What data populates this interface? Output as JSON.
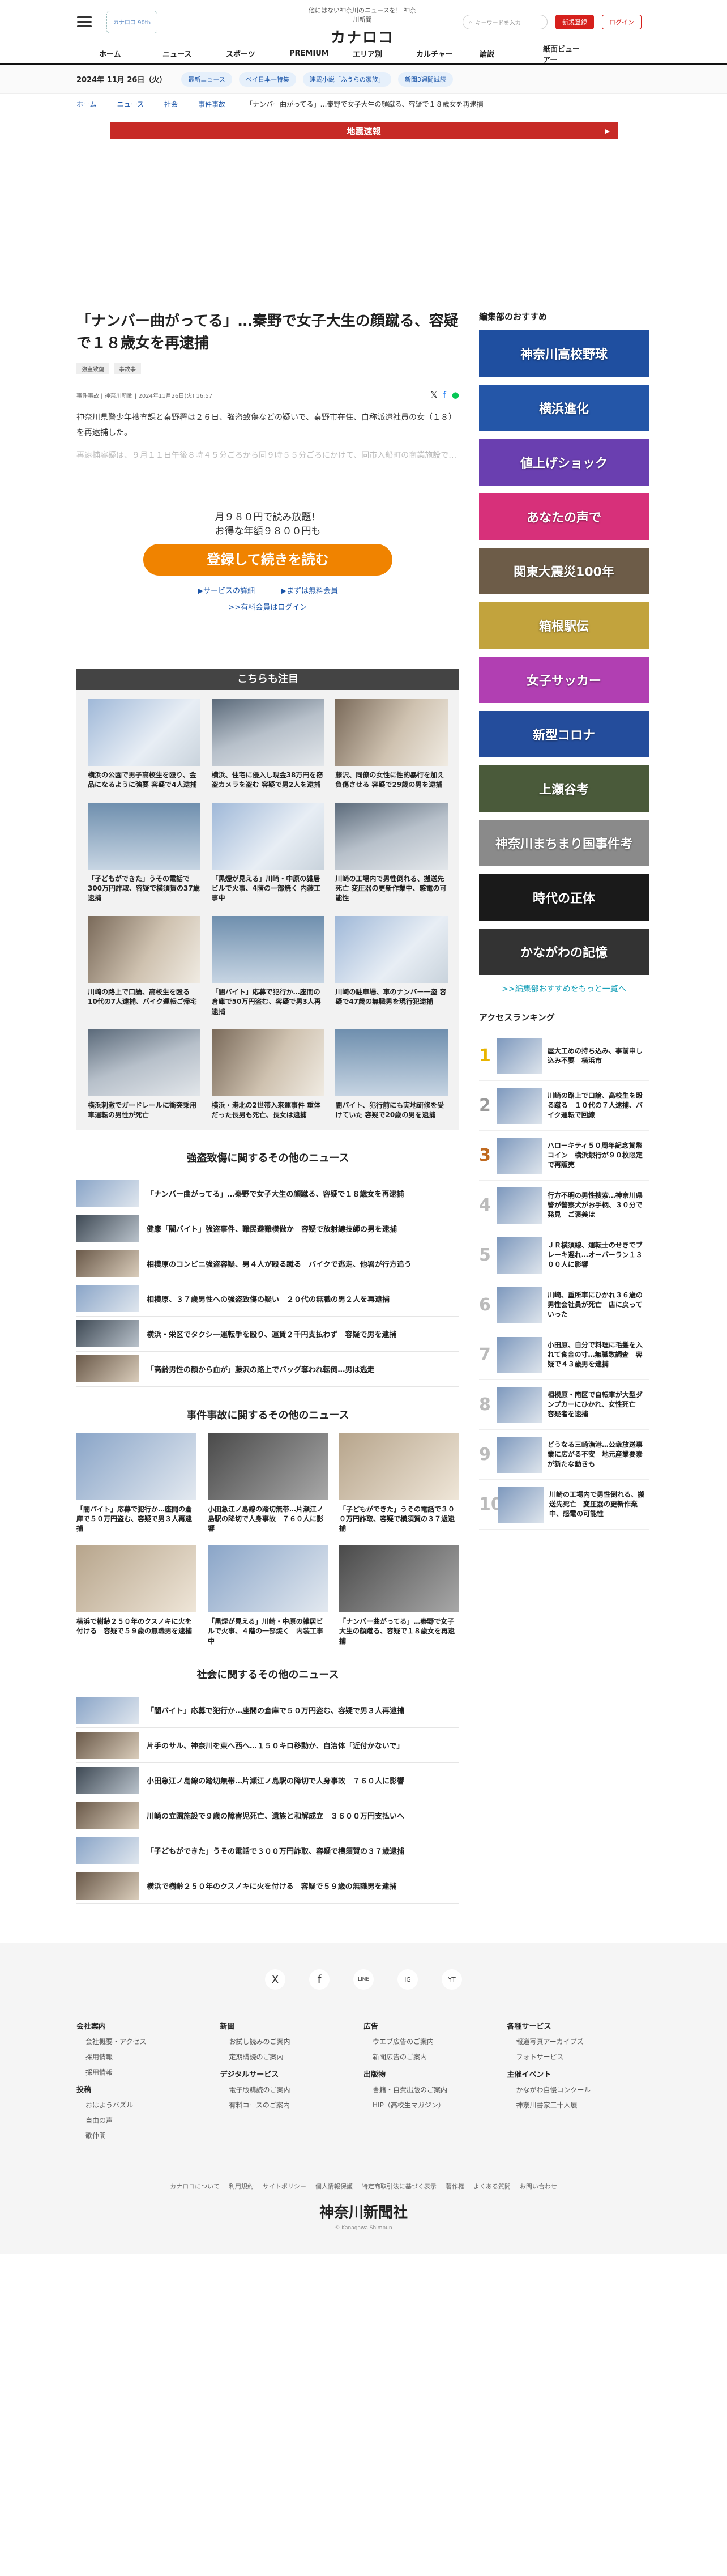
{
  "header": {
    "logo_text": "カナロコ 90th",
    "tagline": "他にはない神奈川のニュースを！ 神奈川新聞",
    "brand": "カナロコ",
    "search_placeholder": "キーワードを入力",
    "register": "新規登録",
    "login": "ログイン"
  },
  "gnav": [
    "ホーム",
    "ニュース",
    "スポーツ",
    "PREMIUM",
    "エリア別",
    "カルチャー",
    "論説",
    "紙面ビューアー"
  ],
  "subbar": {
    "date": "2024年 11月 26日（火）",
    "chips": [
      "最新ニュース",
      "ベイ日本一特集",
      "連載小説「ふうらの家族」",
      "新聞3週間試読"
    ]
  },
  "breadcrumbs": [
    "ホーム",
    "ニュース",
    "社会",
    "事件事故",
    "「ナンバー曲がってる」…秦野で女子大生の顔蹴る、容疑で１８歳女を再逮捕"
  ],
  "alert": "地震速報",
  "article": {
    "title": "「ナンバー曲がってる」…秦野で女子大生の顔蹴る、容疑で１８歳女を再逮捕",
    "tags": [
      "強盗致傷",
      "事故事"
    ],
    "meta": "事件事故 | 神奈川新聞 | 2024年11月26日(火) 16:57",
    "p1": "神奈川県警少年捜査課と秦野署は２６日、強盗致傷などの疑いで、秦野市在住、自称派遣社員の女（１８）を再逮捕した。",
    "p2": "再逮捕容疑は、９月１１日午後８時４５分ごろから同９時５５分ごろにかけて、同市入船町の商業施設で…"
  },
  "paywall": {
    "line1": "月９８０円で読み放題！",
    "line2": "お得な年額９８００円も",
    "cta": "登録して続きを読む",
    "link1": "▶サービスの詳細",
    "link2": "▶まずは無料会員",
    "login": ">>有料会員はログイン"
  },
  "focus": {
    "heading": "こちらも注目",
    "items": [
      "横浜の公園で男子高校生を殴り、金品になるように強要 容疑で4人逮捕",
      "横浜、住宅に侵入し現金38万円を窃盗カメラを盗む 容疑で男2人を逮捕",
      "藤沢、同僚の女性に性的暴行を加え負傷させる 容疑で29歳の男を逮捕",
      "「子どもができた」うその電話で300万円詐取、容疑で横須賀の37歳逮捕",
      "「黒煙が見える」川崎・中原の雑居ビルで火事、4階の一部焼く 内装工事中",
      "川崎の工場内で男性倒れる、搬送先死亡 変圧器の更新作業中、感電の可能性",
      "川崎の路上で口論、高校生を殴る 10代の7人逮捕、バイク運転ご帰宅",
      "「闇バイト」応募で犯行か…座間の倉庫で50万円盗む、容疑で男3人再逮捕",
      "川崎の駐車場、車のナンバー一盗 容疑で47歳の無職男を現行犯逮捕",
      "横浜刺激でガードレールに衝突乗用車運転の男性が死亡",
      "横浜・港北の2世帯入来運事件 重体だった長男も死亡、長女は逮捕",
      "闇バイト、犯行前にも実地研修を受けていた 容疑で20歳の男を逮捕"
    ]
  },
  "related1": {
    "heading": "強盗致傷に関するその他のニュース",
    "items": [
      "「ナンバー曲がってる」…秦野で女子大生の顔蹴る、容疑で１８歳女を再逮捕",
      "健康「闇バイト」強盗事件、難民避難模倣か　容疑で放射線技師の男を逮捕",
      "相模原のコンビニ強盗容疑、男４人が殴る蹴る　バイクで逃走、他署が行方追う",
      "相模原、３７歳男性への強盗致傷の疑い　２０代の無職の男２人を再逮捕",
      "横浜・栄区でタクシー運転手を殴り、運賃２千円支払わず　容疑で男を逮捕",
      "「高齢男性の顔から血が」藤沢の路上でバッグ奪われ転倒…男は逃走"
    ]
  },
  "related2": {
    "heading": "事件事故に関するその他のニュース",
    "items": [
      "「闇バイト」応募で犯行か…座間の倉庫で５０万円盗む、容疑で男３人再逮捕",
      "小田急江ノ島線の踏切無帯…片瀬江ノ島駅の降切で人身事故　７６０人に影響",
      "「子どもができた」うその電話で３００万円詐取、容疑で横須賀の３７歳逮捕",
      "横浜で樹齢２５０年のクスノキに火を付ける　容疑で５９歳の無職男を逮捕",
      "「黒煙が見える」川崎・中原の雑居ビルで火事、４階の一部焼く　内装工事中",
      "「ナンバー曲がってる」…秦野で女子大生の顔蹴る、容疑で１８歳女を再逮捕"
    ]
  },
  "related3": {
    "heading": "社会に関するその他のニュース",
    "items": [
      "「闇バイト」応募で犯行か…座間の倉庫で５０万円盗む、容疑で男３人再逮捕",
      "片手のサル、神奈川を東へ西へ…１５０キロ移動か、自治体「近付かないで」",
      "小田急江ノ島線の踏切無帯…片瀬江ノ島駅の降切で人身事故　７６０人に影響",
      "川崎の立園施設で９歳の障害児死亡、遺族と和解成立　３６００万円支払いへ",
      "「子どもができた」うその電話で３００万円詐取、容疑で横須賀の３７歳逮捕",
      "横浜で樹齢２５０年のクスノキに火を付ける　容疑で５９歳の無職男を逮捕"
    ]
  },
  "side": {
    "heading": "編集部のおすすめ",
    "banners": [
      {
        "text": "神奈川高校野球",
        "color": "#1f4fa0"
      },
      {
        "text": "横浜進化",
        "color": "#2456a8"
      },
      {
        "text": "値上げショック",
        "color": "#6a3fb0"
      },
      {
        "text": "あなたの声で",
        "color": "#d7307a"
      },
      {
        "text": "関東大震災100年",
        "color": "#6d5c48"
      },
      {
        "text": "箱根駅伝",
        "color": "#c2a33d"
      },
      {
        "text": "女子サッカー",
        "color": "#b13fb2"
      },
      {
        "text": "新型コロナ",
        "color": "#244d9c"
      },
      {
        "text": "上瀬谷考",
        "color": "#4a5a3a"
      },
      {
        "text": "神奈川まちまり国事件考",
        "color": "#8a8a8a"
      },
      {
        "text": "時代の正体",
        "color": "#1a1a1a"
      },
      {
        "text": "かながわの記憶",
        "color": "#333333"
      }
    ],
    "more": ">>編集部おすすめをもっと一覧へ",
    "ranking_heading": "アクセスランキング",
    "ranking": [
      "屋大工めの持ち込み、事前申し込み不要　横浜市",
      "川崎の路上で口論、高校生を殴る蹴る　１０代の７人逮捕、バイク運転で回線",
      "ハローキティ５０周年記念貨幣コイン　横浜銀行が９０枚限定で再販売",
      "行方不明の男性捜索…神奈川県警が警察犬がお手柄、３０分で発見　ご褒美は",
      "ＪＲ横須線、運転士のせきでブレーキ遅れ…オーバーラン１３００人に影響",
      "川崎、重所車にひかれ３６歳の男性会社員が死亡　店に戻っていった",
      "小田原、自分で料理に毛髪を入れて食金の寸…無職数調査　容疑で４３歳男を逮捕",
      "相模原・南区で自転車が大型ダンプカーにひかれ、女性死亡　容疑者を逮捕",
      "どうなる三崎漁港…公衆放送事業に広がる不安　地元産業要素が新たな動きも",
      "川崎の工場内で男性倒れる、搬送先死亡　変圧器の更新作業中、感電の可能性"
    ]
  },
  "footer": {
    "social": [
      "X",
      "f",
      "LINE",
      "IG",
      "YT"
    ],
    "cols": [
      {
        "h": "会社案内",
        "links": [
          "会社概要・アクセス",
          "採用情報",
          "採用情報"
        ]
      },
      {
        "h": "新聞",
        "links": [
          "お試し読みのご案内",
          "定期購読のご案内"
        ]
      },
      {
        "h": "広告",
        "links": [
          "ウエブ広告のご案内",
          "新聞広告のご案内"
        ]
      },
      {
        "h": "各種サービス",
        "links": [
          "報道写真アーカイブズ",
          "フォトサービス"
        ]
      }
    ],
    "cols2": [
      {
        "h": "投稿",
        "links": [
          "おはようバズル",
          "自由の声",
          "歌仲間"
        ]
      },
      {
        "h": "デジタルサービス",
        "links": [
          "電子版購読のご案内",
          "有料コースのご案内"
        ]
      },
      {
        "h": "出版物",
        "links": [
          "書籍・自費出版のご案内",
          "HIP（高校生マガジン）"
        ]
      },
      {
        "h": "主催イベント",
        "links": [
          "かながわ自慢コンクール",
          "神奈川書家三十人展"
        ]
      }
    ],
    "bottom_links": [
      "カナロコについて",
      "利用規約",
      "サイトポリシー",
      "個人情報保護",
      "特定商取引法に基づく表示",
      "著作権",
      "よくある質問",
      "お問い合わせ"
    ],
    "logo": "神奈川新聞社",
    "copy": "© Kanagawa Shimbun"
  }
}
